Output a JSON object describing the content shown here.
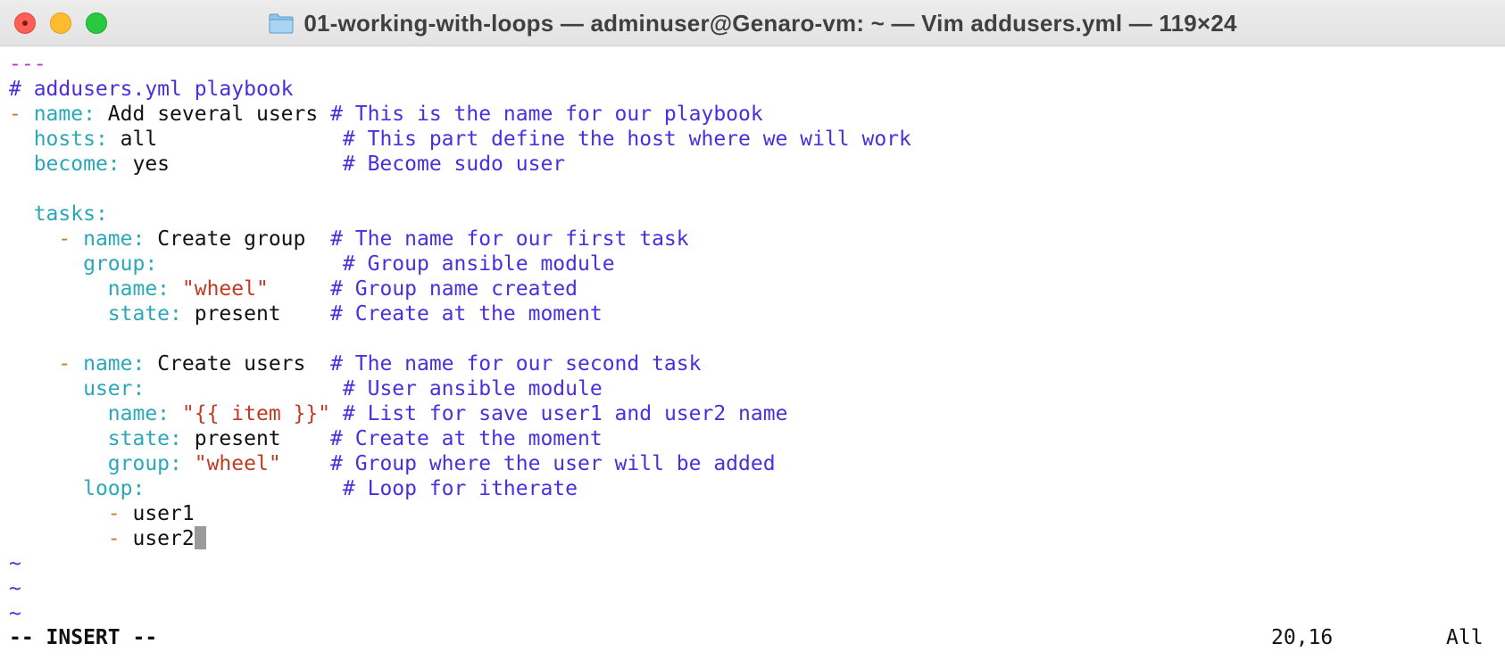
{
  "window": {
    "title": "01-working-with-loops — adminuser@Genaro-vm: ~ — Vim addusers.yml — 119×24",
    "folder_icon": "folder-icon"
  },
  "editor": {
    "lines": [
      [
        {
          "t": "---",
          "c": "docsep"
        }
      ],
      [
        {
          "t": "# addusers.yml playbook",
          "c": "comment"
        }
      ],
      [
        {
          "t": "- ",
          "c": "dash"
        },
        {
          "t": "name:",
          "c": "key"
        },
        {
          "t": " Add several users ",
          "c": "text"
        },
        {
          "t": "# This is the name for our playbook",
          "c": "comment"
        }
      ],
      [
        {
          "t": "  ",
          "c": "text"
        },
        {
          "t": "hosts:",
          "c": "key"
        },
        {
          "t": " all               ",
          "c": "text"
        },
        {
          "t": "# This part define the host where we will work",
          "c": "comment"
        }
      ],
      [
        {
          "t": "  ",
          "c": "text"
        },
        {
          "t": "become:",
          "c": "key"
        },
        {
          "t": " yes              ",
          "c": "text"
        },
        {
          "t": "# Become sudo user",
          "c": "comment"
        }
      ],
      [],
      [
        {
          "t": "  ",
          "c": "text"
        },
        {
          "t": "tasks:",
          "c": "key"
        }
      ],
      [
        {
          "t": "    ",
          "c": "text"
        },
        {
          "t": "- ",
          "c": "dash"
        },
        {
          "t": "name:",
          "c": "key"
        },
        {
          "t": " Create group  ",
          "c": "text"
        },
        {
          "t": "# The name for our first task",
          "c": "comment"
        }
      ],
      [
        {
          "t": "      ",
          "c": "text"
        },
        {
          "t": "group:",
          "c": "key"
        },
        {
          "t": "               ",
          "c": "text"
        },
        {
          "t": "# Group ansible module",
          "c": "comment"
        }
      ],
      [
        {
          "t": "        ",
          "c": "text"
        },
        {
          "t": "name:",
          "c": "key"
        },
        {
          "t": " ",
          "c": "text"
        },
        {
          "t": "\"wheel\"",
          "c": "str"
        },
        {
          "t": "     ",
          "c": "text"
        },
        {
          "t": "# Group name created",
          "c": "comment"
        }
      ],
      [
        {
          "t": "        ",
          "c": "text"
        },
        {
          "t": "state:",
          "c": "key"
        },
        {
          "t": " present    ",
          "c": "text"
        },
        {
          "t": "# Create at the moment",
          "c": "comment"
        }
      ],
      [],
      [
        {
          "t": "    ",
          "c": "text"
        },
        {
          "t": "- ",
          "c": "dash"
        },
        {
          "t": "name:",
          "c": "key"
        },
        {
          "t": " Create users  ",
          "c": "text"
        },
        {
          "t": "# The name for our second task",
          "c": "comment"
        }
      ],
      [
        {
          "t": "      ",
          "c": "text"
        },
        {
          "t": "user:",
          "c": "key"
        },
        {
          "t": "                ",
          "c": "text"
        },
        {
          "t": "# User ansible module",
          "c": "comment"
        }
      ],
      [
        {
          "t": "        ",
          "c": "text"
        },
        {
          "t": "name:",
          "c": "key"
        },
        {
          "t": " ",
          "c": "text"
        },
        {
          "t": "\"{{ item }}\"",
          "c": "str"
        },
        {
          "t": " ",
          "c": "text"
        },
        {
          "t": "# List for save user1 and user2 name",
          "c": "comment"
        }
      ],
      [
        {
          "t": "        ",
          "c": "text"
        },
        {
          "t": "state:",
          "c": "key"
        },
        {
          "t": " present    ",
          "c": "text"
        },
        {
          "t": "# Create at the moment",
          "c": "comment"
        }
      ],
      [
        {
          "t": "        ",
          "c": "text"
        },
        {
          "t": "group:",
          "c": "key"
        },
        {
          "t": " ",
          "c": "text"
        },
        {
          "t": "\"wheel\"",
          "c": "str"
        },
        {
          "t": "    ",
          "c": "text"
        },
        {
          "t": "# Group where the user will be added",
          "c": "comment"
        }
      ],
      [
        {
          "t": "      ",
          "c": "text"
        },
        {
          "t": "loop:",
          "c": "key"
        },
        {
          "t": "                ",
          "c": "text"
        },
        {
          "t": "# Loop for itherate",
          "c": "comment"
        }
      ],
      [
        {
          "t": "        ",
          "c": "text"
        },
        {
          "t": "- ",
          "c": "dash"
        },
        {
          "t": "user1",
          "c": "text"
        }
      ],
      [
        {
          "t": "        ",
          "c": "text"
        },
        {
          "t": "- ",
          "c": "dash"
        },
        {
          "t": "user2",
          "c": "text"
        }
      ],
      [
        {
          "t": "~",
          "c": "tilde"
        }
      ],
      [
        {
          "t": "~",
          "c": "tilde"
        }
      ],
      [
        {
          "t": "~",
          "c": "tilde"
        }
      ]
    ],
    "cursor_line": 20
  },
  "statusbar": {
    "mode": "-- INSERT --",
    "position": "20,16",
    "scroll": "All"
  },
  "colors": {
    "comment": "#4a2ee0",
    "key": "#2aa8b8",
    "dash": "#c87a20",
    "string": "#c03a24",
    "doc_separator": "#c238d0"
  }
}
